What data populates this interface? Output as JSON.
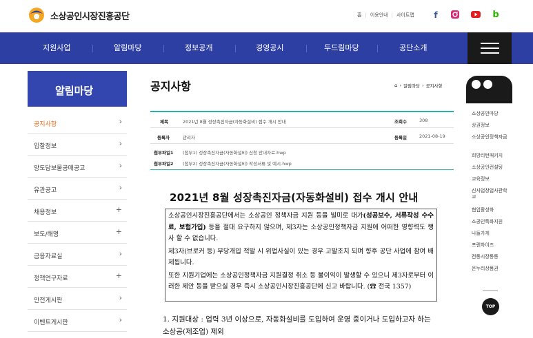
{
  "header": {
    "org_name": "소상공인시장진흥공단",
    "util_links": [
      "홈",
      "이용안내",
      "사이트맵"
    ],
    "sns": [
      {
        "name": "facebook-icon",
        "glyph": "f",
        "color": "#3b5998"
      },
      {
        "name": "instagram-icon",
        "glyph": "◘",
        "color": "#d62976"
      },
      {
        "name": "youtube-icon",
        "glyph": "▶",
        "color": "#e02020"
      },
      {
        "name": "blog-icon",
        "glyph": "b",
        "color": "#2db400"
      }
    ]
  },
  "gnb": {
    "items": [
      "지원사업",
      "알림마당",
      "정보공개",
      "경영공시",
      "두드림마당",
      "공단소개"
    ]
  },
  "sidebar": {
    "title": "알림마당",
    "items": [
      {
        "label": "공지사항",
        "marker": "›"
      },
      {
        "label": "입찰정보",
        "marker": "›"
      },
      {
        "label": "양도담보물공매공고",
        "marker": "›"
      },
      {
        "label": "유관공고",
        "marker": "›"
      },
      {
        "label": "채용정보",
        "marker": "+"
      },
      {
        "label": "보도/해명",
        "marker": "+"
      },
      {
        "label": "금융자료실",
        "marker": "›"
      },
      {
        "label": "정책연구자료",
        "marker": "+"
      },
      {
        "label": "안전게시판",
        "marker": "›"
      },
      {
        "label": "이벤트게시판",
        "marker": "›"
      }
    ]
  },
  "page": {
    "title": "공지사항",
    "breadcrumb": [
      "알림마당",
      "공지사항"
    ]
  },
  "post": {
    "subject_label": "제목",
    "subject": "2021년 8월 성장촉진자금(자동화설비) 접수 개시 안내",
    "views_label": "조회수",
    "views": "308",
    "author_label": "등록자",
    "author": "관리자",
    "date_label": "등록일",
    "date": "2021-08-19",
    "attachments": [
      {
        "label": "첨부파일1",
        "file": "(첨부1) 성장촉진자금(자동화설비) 신청 안내자료.hwp"
      },
      {
        "label": "첨부파일2",
        "file": "(첨부2) 성장촉진자금(자동화설비) 작성서류 및 예시.hwp"
      }
    ]
  },
  "body": {
    "doc_title": "2021년 8월 성장촉진자금(자동화설비) 접수 개시 안내",
    "notice_p1_a": "소상공인시장진흥공단에서는 소상공인 정책자금 지원 등을 빌미로 대가",
    "notice_p1_bold": "(성공보수, 서류작성 수수료, 보험가입)",
    "notice_p1_b": " 등을 절대 요구하지 않으며, 제3자는 소상공인정책자금 지원에 어떠한 영향력도 행사 할 수 없습니다.",
    "notice_p2": "제3자(브로커 등) 부당개입 적발 시 위법사실이 있는 경우 고발조치 되며 향후 공단 사업에 참여 배제됩니다.",
    "notice_p3": "또한 지원기업에는 소상공인정책자금 지원결정 취소 등 불이익이 발생할 수 있으니 제3자로부터 이러한 제안 등을 받으실 경우 즉시 소상공인시장진흥공단에 신고 바랍니다.",
    "notice_phone": "(☎ 전국 1357)",
    "item1": "1. 지원대상 : 업력 3년 이상으로, 자동화설비를 도입하여 운영 중이거나 도입하고자 하는 소상공(제조업) 제외"
  },
  "quick": {
    "items": [
      "소상공인마당",
      "상권정보",
      "소상공인정책자금",
      "희망리턴패키지",
      "소상공인컨설팅",
      "교육정보",
      "신사업창업사관학교",
      "협업활성화",
      "소공인특화지원",
      "나들가게",
      "프랜차이즈",
      "전통시장통통",
      "온누리상품권"
    ],
    "top_label": "TOP"
  }
}
